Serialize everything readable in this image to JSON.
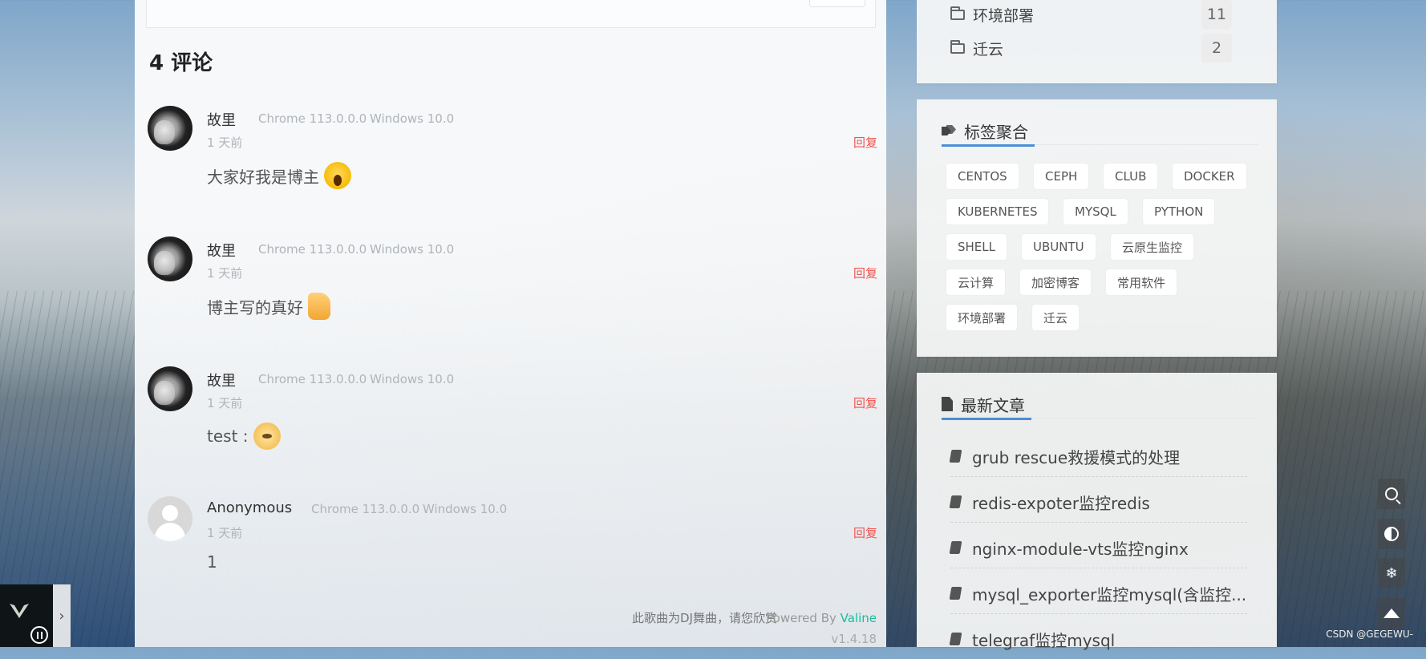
{
  "comments_header": "4 评论",
  "comments": [
    {
      "nick": "故里",
      "browser": "Chrome 113.0.0.0",
      "os": "Windows 10.0",
      "time": "1 天前",
      "reply": "回复",
      "text": "大家好我是博主",
      "emoji": "scream-emoji-icon"
    },
    {
      "nick": "故里",
      "browser": "Chrome 113.0.0.0",
      "os": "Windows 10.0",
      "time": "1 天前",
      "reply": "回复",
      "text": "博主写的真好",
      "emoji": "thumbs-up-emoji-icon"
    },
    {
      "nick": "故里",
      "browser": "Chrome 113.0.0.0",
      "os": "Windows 10.0",
      "time": "1 天前",
      "reply": "回复",
      "text": "test :",
      "emoji": "doge-emoji-icon"
    },
    {
      "nick": "Anonymous",
      "browser": "Chrome 113.0.0.0",
      "os": "Windows 10.0",
      "time": "1 天前",
      "reply": "回复",
      "text": "1",
      "emoji": ""
    }
  ],
  "footer": {
    "music_note": "此歌曲为DJ舞曲，请您欣赏",
    "powered_prefix": "Powered By ",
    "powered_brand": "Valine",
    "version": "v1.4.18"
  },
  "categories": [
    {
      "name": "环境部署",
      "count": "11"
    },
    {
      "name": "迁云",
      "count": "2"
    }
  ],
  "tag_cloud": {
    "title": "标签聚合",
    "tags": [
      "CENTOS",
      "CEPH",
      "CLUB",
      "DOCKER",
      "KUBERNETES",
      "MYSQL",
      "PYTHON",
      "SHELL",
      "UBUNTU",
      "云原生监控",
      "云计算",
      "加密博客",
      "常用软件",
      "环境部署",
      "迁云"
    ]
  },
  "recent_posts": {
    "title": "最新文章",
    "posts": [
      "grub rescue救援模式的处理",
      "redis-expoter监控redis",
      "nginx-module-vts监控nginx",
      "mysql_exporter监控mysql(含监控...",
      "telegraf监控mysql"
    ]
  },
  "tools": [
    "search-icon",
    "contrast-icon",
    "snowflake-icon",
    "back-to-top-icon"
  ],
  "snowflake_glyph": "❄",
  "watermark": "CSDN @GEGEWU-",
  "colors": {
    "reply": "#ef5350",
    "accent": "#4a8fd6",
    "brand": "#1abc9c"
  }
}
